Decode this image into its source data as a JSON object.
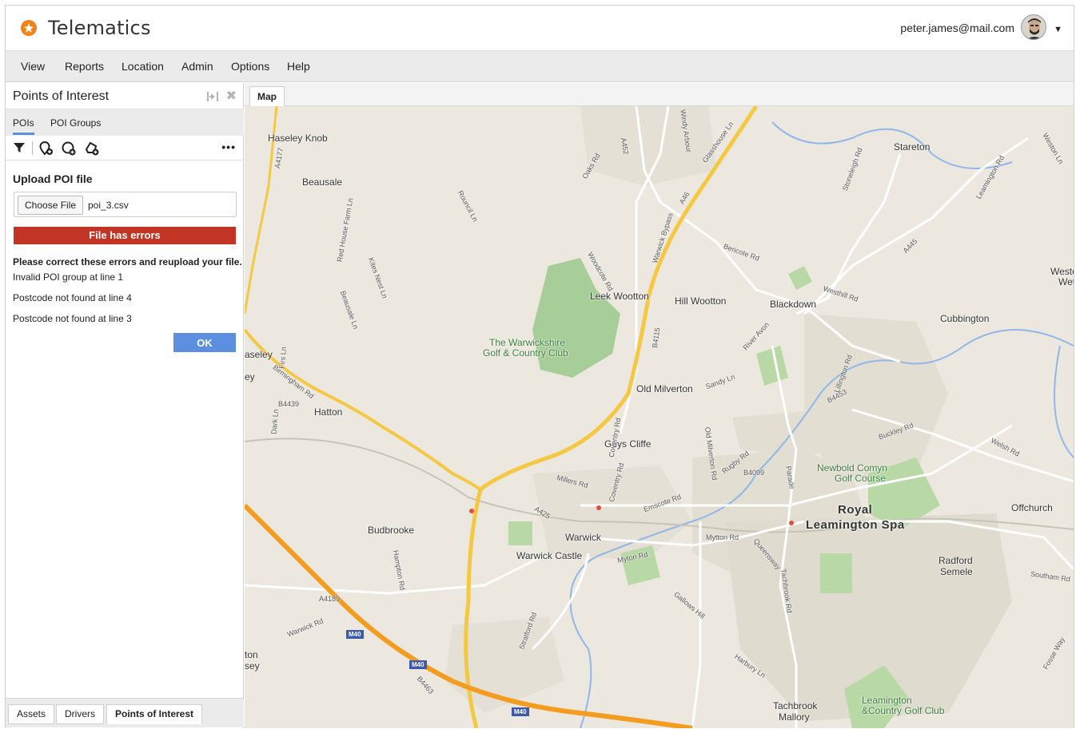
{
  "app": {
    "title": "Telematics",
    "user_email": "peter.james@mail.com"
  },
  "menu": {
    "items": [
      "View",
      "Reports",
      "Location",
      "Admin",
      "Options",
      "Help"
    ]
  },
  "panel": {
    "title": "Points of Interest",
    "subtabs": [
      "POIs",
      "POI Groups"
    ],
    "active_subtab": "POIs",
    "toolbar_icons": [
      "filter-icon",
      "add-poi-icon",
      "add-circle-icon",
      "add-polygon-icon",
      "more-icon"
    ],
    "upload": {
      "title": "Upload POI file",
      "choose_label": "Choose File",
      "file_name": "poi_3.csv",
      "error_banner": "File has errors",
      "error_heading": "Please correct these errors and reupload your file.",
      "errors": [
        "Invalid POI group at line 1",
        "Postcode not found at line 4",
        "Postcode not found at line 3"
      ],
      "ok_label": "OK"
    },
    "bottom_tabs": [
      "Assets",
      "Drivers",
      "Points of Interest"
    ],
    "active_bottom_tab": "Points of Interest"
  },
  "map": {
    "tab_label": "Map",
    "places": [
      "Haseley Knob",
      "Beausale",
      "Stareton",
      "Weston",
      "Wethe",
      "Leek Wootton",
      "Hill Wootton",
      "Blackdown",
      "Cubbington",
      "The Warwickshire",
      "Golf & Country Club",
      "aseley",
      "ey",
      "Old Milverton",
      "Hatton",
      "Guys Cliffe",
      "Newbold Comyn",
      "Golf Course",
      "Royal",
      "Leamington Spa",
      "Offchurch",
      "Budbrooke",
      "Warwick",
      "Warwick Castle",
      "Radford",
      "Semele",
      "ton",
      "sey",
      "Tachbrook",
      "Mallory",
      "Leamington",
      "&Country Golf Club"
    ],
    "roads": [
      "A4177",
      "Oaks Rd",
      "Woodcote Rd",
      "Glasshouse Ln",
      "A452",
      "A46",
      "Warwick Bypass",
      "Birmingham Rd",
      "B4439",
      "A425",
      "Emscote Rd",
      "Coventry Rd",
      "Millers Rd",
      "Mytton Rd",
      "Myton Rd",
      "A4189",
      "Warwick Rd",
      "M40",
      "B4463",
      "Stratford Rd",
      "Gallows Hill",
      "Harbury Ln",
      "Tachbrook Rd",
      "Rugby Rd",
      "B4099",
      "Parade",
      "B4453",
      "Buckley Rd",
      "Welsh Rd",
      "Southam Rd",
      "Fosse Way",
      "B4115",
      "Bericote Rd",
      "Westhill Rd",
      "A445",
      "River Avon",
      "Sandy Ln",
      "Lillington Rd",
      "Old Milverton Rd",
      "Rouncil Ln",
      "Kites Nest Ln",
      "Beausale Ln",
      "Firs Ln",
      "Dark Ln",
      "Hampton Rd",
      "Queensway",
      "Coventry Rd",
      "Stoneleigh Rd",
      "Leamington Rd",
      "Weston Ln",
      "Windy Arbour",
      "Red House Farm Ln"
    ]
  },
  "colors": {
    "accent": "#f0831c",
    "error": "#c23424",
    "primary_button": "#5d8fe0",
    "tab_underline": "#5b8fd8"
  }
}
